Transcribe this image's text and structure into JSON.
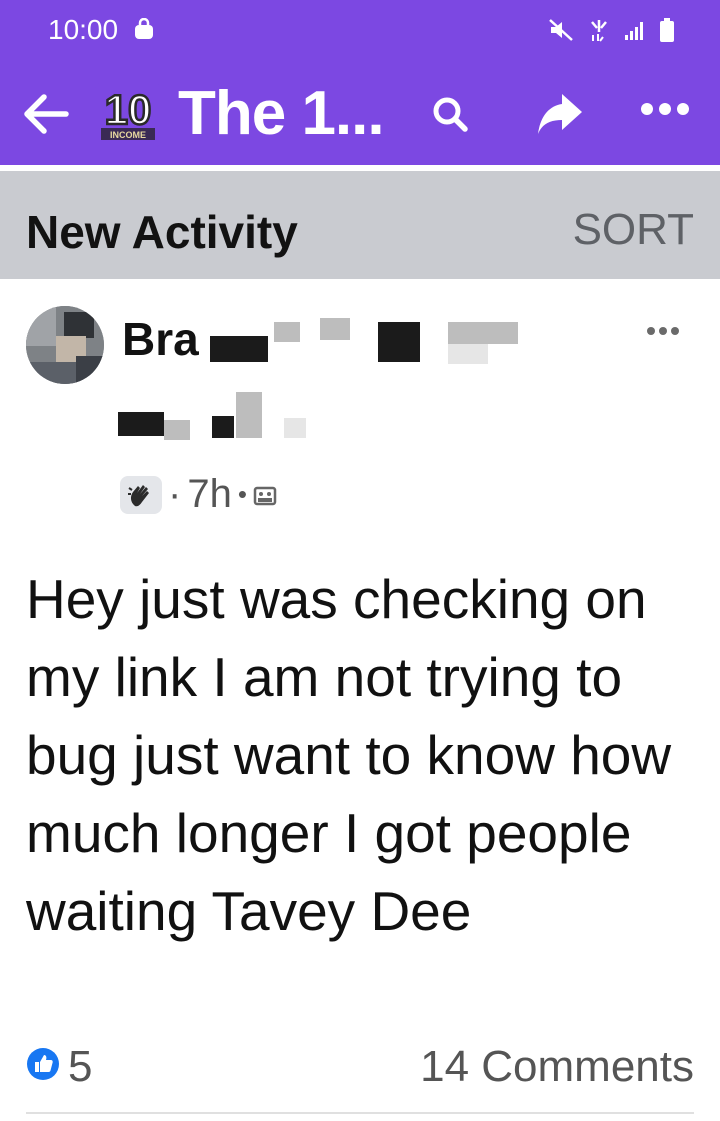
{
  "status_bar": {
    "time": "10:00"
  },
  "app_bar": {
    "title": "The 1...",
    "logo": {
      "number": "10",
      "subtext": "INCOME"
    }
  },
  "section": {
    "heading": "New Activity",
    "sort_label": "SORT"
  },
  "post": {
    "author_visible": "Bra",
    "time": "7h",
    "separator": "·",
    "dot": "•",
    "body": "Hey just was checking on my link I am not trying to bug just want to know how much longer I got people waiting Tavey Dee",
    "like_count": "5",
    "comments_label": "14 Comments"
  },
  "colors": {
    "brand": "#7c48e2",
    "section_bg": "#c9cbd0",
    "like_blue": "#1877f2"
  },
  "icons": [
    "back-arrow-icon",
    "search-icon",
    "share-icon",
    "more-icon",
    "bag-icon",
    "mute-icon",
    "wifi-icon",
    "signal-icon",
    "battery-icon",
    "wave-icon",
    "privacy-icon",
    "like-icon"
  ]
}
